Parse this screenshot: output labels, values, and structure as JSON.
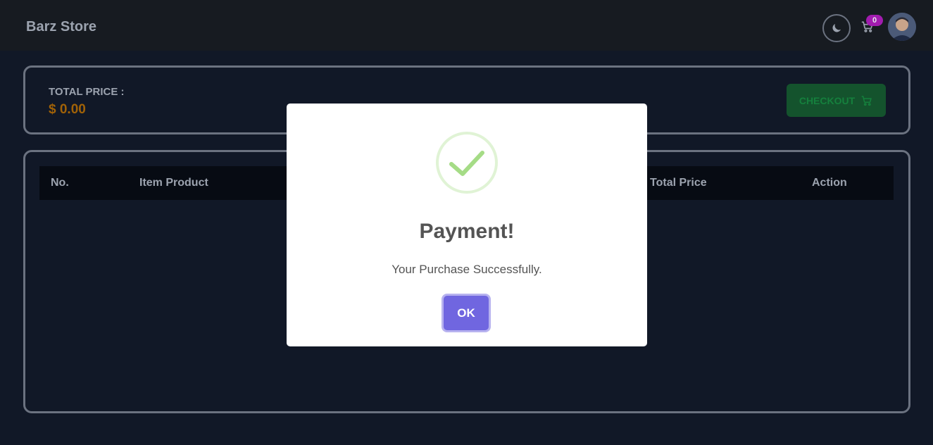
{
  "navbar": {
    "brand": "Barz Store",
    "cart_count": "0",
    "icons": {
      "theme": "moon-icon",
      "cart": "cart-icon",
      "avatar": "user-avatar"
    }
  },
  "summary": {
    "total_label": "TOTAL PRICE :",
    "total_value": "$ 0.00",
    "checkout_label": "CHECKOUT"
  },
  "table": {
    "columns": [
      "No.",
      "Item Product",
      "Total Price",
      "Action"
    ],
    "rows": []
  },
  "modal": {
    "title": "Payment!",
    "message": "Your Purchase Successfully.",
    "confirm_label": "OK",
    "icon": "success-check-icon"
  },
  "colors": {
    "background": "#111827",
    "navbar": "#171b21",
    "accent_total": "#a16207",
    "checkout_bg": "#14532d",
    "badge": "#a21caf",
    "ok_button": "#7066e0",
    "success": "#a5dc86"
  }
}
